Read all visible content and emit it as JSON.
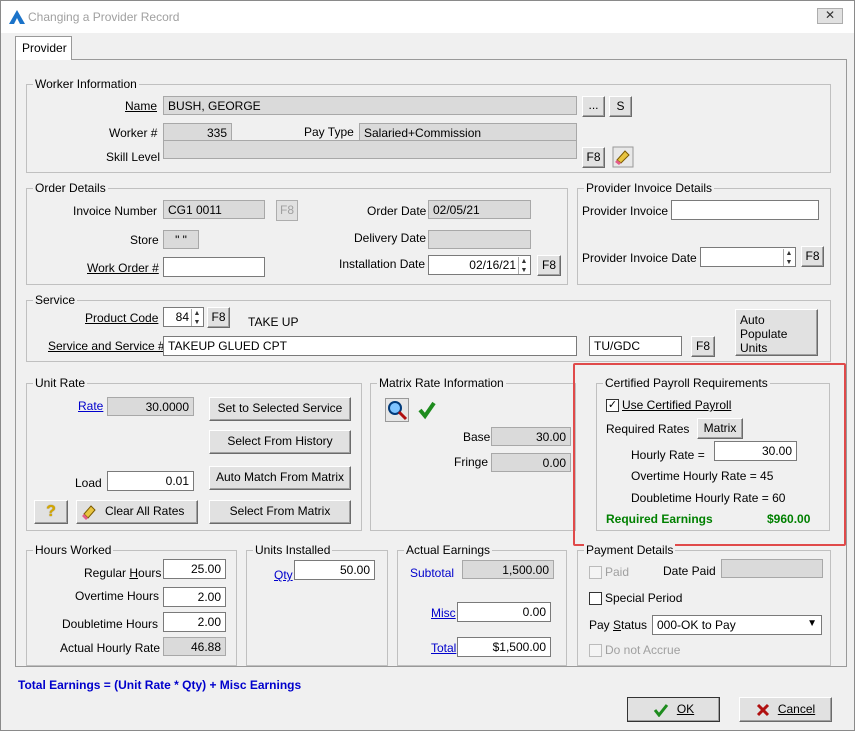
{
  "window": {
    "title": "Changing a Provider Record",
    "close": "✕"
  },
  "tab": {
    "label": "Provider"
  },
  "worker": {
    "legend": "Worker Information",
    "name_label": "Name",
    "name_value": "BUSH, GEORGE",
    "browse_btn": "...",
    "s_btn": "S",
    "worker_no_label": "Worker #",
    "worker_no_value": "335",
    "pay_type_label": "Pay Type",
    "pay_type_value": "Salaried+Commission",
    "skill_label": "Skill Level",
    "skill_value": "",
    "f8": "F8"
  },
  "order": {
    "legend": "Order Details",
    "invoice_label": "Invoice Number",
    "invoice_value": "CG1 0011",
    "f8": "F8",
    "store_label": "Store",
    "store_value": "\" \"",
    "work_order_label": "Work Order #",
    "work_order_value": "",
    "order_date_label": "Order Date",
    "order_date_value": "02/05/21",
    "delivery_label": "Delivery Date",
    "delivery_value": "",
    "install_label": "Installation Date",
    "install_value": "02/16/21",
    "install_f8": "F8"
  },
  "provider_invoice": {
    "legend": "Provider Invoice Details",
    "invoice_label": "Provider Invoice",
    "invoice_value": "",
    "date_label": "Provider Invoice Date",
    "date_value": "",
    "f8": "F8"
  },
  "service": {
    "legend": "Service",
    "product_label": "Product Code",
    "product_value": "84",
    "f8": "F8",
    "product_desc": "TAKE UP",
    "service_label": "Service and Service #",
    "service_value": "TAKEUP GLUED CPT",
    "service_code": "TU/GDC",
    "service_f8": "F8",
    "auto_populate": "Auto Populate Units"
  },
  "unit_rate": {
    "legend": "Unit Rate",
    "rate_label": "Rate",
    "rate_value": "30.0000",
    "load_label": "Load",
    "load_value": "0.01",
    "btn_set_selected": "Set to Selected Service",
    "btn_history": "Select From History",
    "btn_auto_match": "Auto Match From Matrix",
    "btn_from_matrix": "Select From Matrix",
    "btn_clear": "Clear All Rates",
    "help_icon": "?"
  },
  "matrix": {
    "legend": "Matrix Rate Information",
    "base_label": "Base",
    "base_value": "30.00",
    "fringe_label": "Fringe",
    "fringe_value": "0.00"
  },
  "certified": {
    "legend": "Certified Payroll Requirements",
    "use_label": "Use Certified Payroll",
    "use_checked": "✓",
    "required_rates": "Required Rates",
    "matrix_btn": "Matrix",
    "hourly_label": "Hourly Rate =",
    "hourly_value": "30.00",
    "overtime_text": "Overtime Hourly Rate = 45",
    "doubletime_text": "Doubletime Hourly Rate = 60",
    "req_earnings_label": "Required Earnings",
    "req_earnings_value": "$960.00",
    "accent_color": "#008000"
  },
  "hours": {
    "legend": "Hours Worked",
    "regular_label": "Regular Hours",
    "regular_value": "25.00",
    "overtime_label": "Overtime Hours",
    "overtime_value": "2.00",
    "doubletime_label": "Doubletime Hours",
    "doubletime_value": "2.00",
    "actual_label": "Actual Hourly Rate",
    "actual_value": "46.88"
  },
  "units": {
    "legend": "Units Installed",
    "qty_label": "Qty",
    "qty_value": "50.00"
  },
  "earnings": {
    "legend": "Actual Earnings",
    "subtotal_label": "Subtotal",
    "subtotal_value": "1,500.00",
    "misc_label": "Misc",
    "misc_value": "0.00",
    "total_label": "Total",
    "total_value": "$1,500.00"
  },
  "payment": {
    "legend": "Payment Details",
    "paid_label": "Paid",
    "date_paid_label": "Date Paid",
    "date_paid_value": "",
    "special_label": "Special Period",
    "pay_status_label": "Pay Status",
    "pay_status_value": "000-OK to Pay",
    "not_accrue_label": "Do not Accrue"
  },
  "formula": "Total Earnings = (Unit Rate * Qty) + Misc Earnings",
  "ok_label": "OK",
  "cancel_label": "Cancel",
  "colors": {
    "link": "#0000cc",
    "highlight": "#e04a4a",
    "formula": "#0000cc"
  }
}
